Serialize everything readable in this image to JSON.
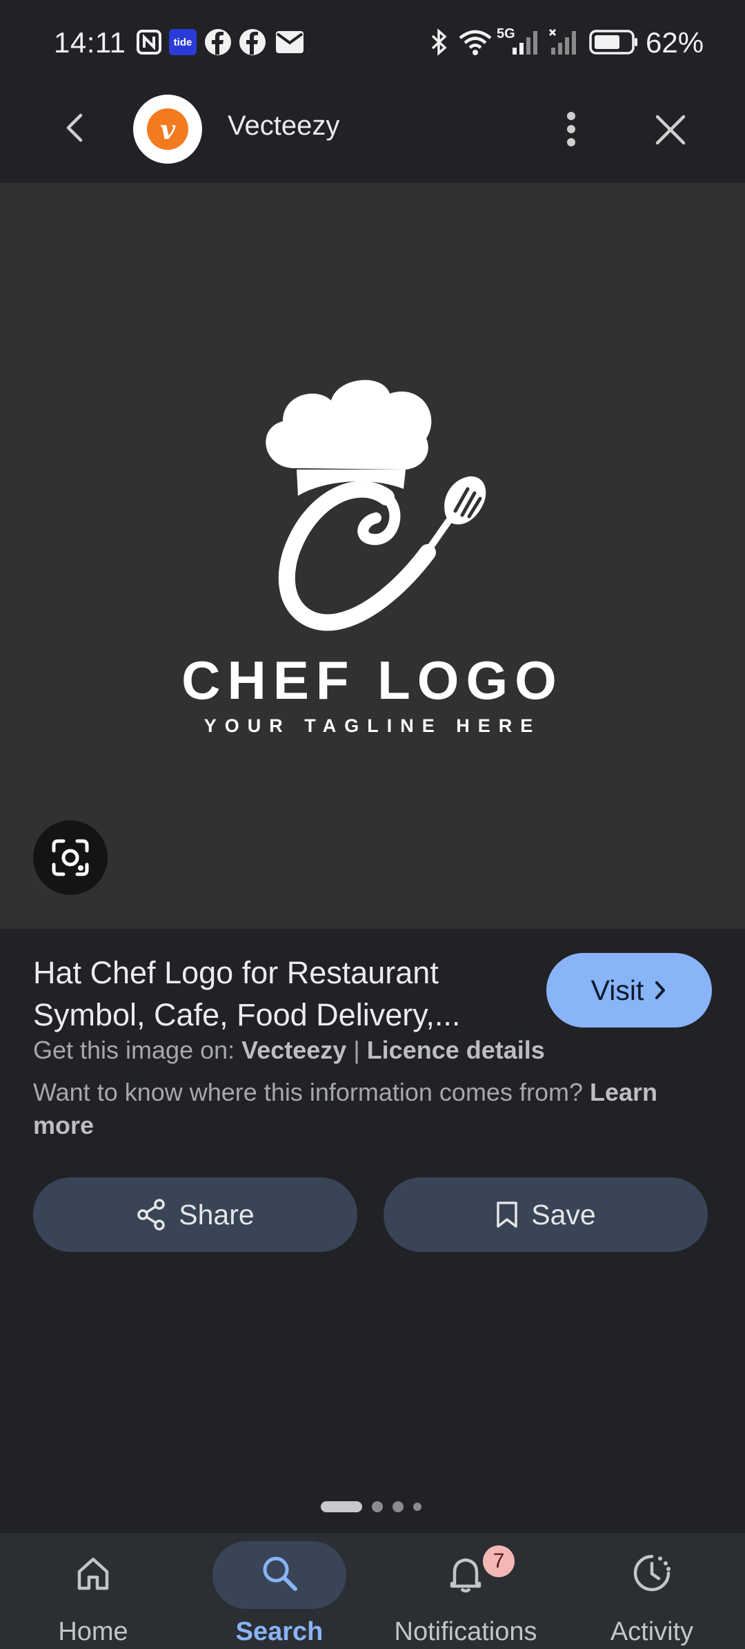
{
  "status_bar": {
    "time": "14:11",
    "battery": "62%",
    "network": "5G",
    "left_icons": [
      "nfc-icon",
      "tide-app-icon",
      "facebook-icon",
      "facebook-icon",
      "mail-icon"
    ],
    "tide_label": "tide",
    "right_icons": [
      "bluetooth-icon",
      "wifi-icon",
      "signal-icon",
      "signal-x-icon",
      "battery-icon"
    ]
  },
  "top_bar": {
    "site_name": "Vecteezy",
    "avatar_letter": "v",
    "back_icon": "back-arrow-icon",
    "more_icon": "more-vert-icon",
    "close_icon": "close-icon"
  },
  "image": {
    "logo_title": "CHEF LOGO",
    "logo_tagline": "YOUR TAGLINE HERE",
    "lens_icon": "google-lens-icon"
  },
  "result": {
    "title": "Hat Chef Logo for Restaurant Symbol, Cafe, Food Delivery,...",
    "visit_label": "Visit",
    "source_prefix": "Get this image on:",
    "source_name": "Vecteezy",
    "separator": "|",
    "licence_label": "Licence details",
    "info_text": "Want to know where this information comes from?",
    "learn_more": "Learn more"
  },
  "actions": {
    "share_label": "Share",
    "save_label": "Save"
  },
  "pagination": {
    "total": 4,
    "active": 0
  },
  "bottom_nav": {
    "items": [
      {
        "label": "Home",
        "icon": "home-icon",
        "active": false
      },
      {
        "label": "Search",
        "icon": "search-icon",
        "active": true
      },
      {
        "label": "Notifications",
        "icon": "bell-icon",
        "active": false,
        "badge": "7"
      },
      {
        "label": "Activity",
        "icon": "activity-icon",
        "active": false
      }
    ]
  },
  "colors": {
    "background": "#202226",
    "image_bg": "#313131",
    "accent": "#8ab4f8",
    "button_bg": "#394457",
    "badge": "#f2b8b5",
    "avatar": "#f47a20"
  }
}
